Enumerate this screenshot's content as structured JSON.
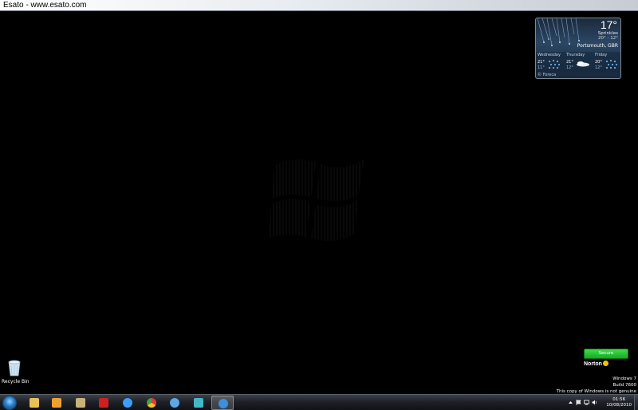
{
  "window": {
    "title": "Esato - www.esato.com"
  },
  "weather": {
    "temperature": "17°",
    "condition": "Sprinkles",
    "range": "20° - 12°",
    "location": "Portsmouth, GBR",
    "credit": "© Foreca",
    "forecast": [
      {
        "day": "Wednesday",
        "high": "21°",
        "low": "11°",
        "icon": "rain-icon"
      },
      {
        "day": "Thursday",
        "high": "21°",
        "low": "12°",
        "icon": "cloud-icon"
      },
      {
        "day": "Friday",
        "high": "20°",
        "low": "12°",
        "icon": "rain-icon"
      }
    ]
  },
  "desktop": {
    "recycle_bin_label": "Recycle Bin"
  },
  "norton": {
    "status": "Secure",
    "brand": "Norton"
  },
  "watermark": {
    "line1": "Windows 7",
    "line2": "Build 7600",
    "line3": "This copy of Windows is not genuine"
  },
  "taskbar": {
    "pinned": [
      {
        "name": "explorer-icon",
        "color": "#e8c15a"
      },
      {
        "name": "media-player-icon",
        "color": "#f0a030"
      },
      {
        "name": "archive-icon",
        "color": "#c9b27a"
      },
      {
        "name": "acrobat-icon",
        "color": "#d01f1f"
      },
      {
        "name": "quicktime-icon",
        "color": "#3aa0ff"
      },
      {
        "name": "chrome-icon",
        "color": "#4caf50"
      },
      {
        "name": "globe-icon",
        "color": "#5aa8e8"
      },
      {
        "name": "pc-suite-icon",
        "color": "#45b7c9"
      },
      {
        "name": "internet-explorer-icon",
        "color": "#3d8fe0"
      }
    ],
    "clock_time": "01:56",
    "clock_date": "10/08/2010"
  }
}
